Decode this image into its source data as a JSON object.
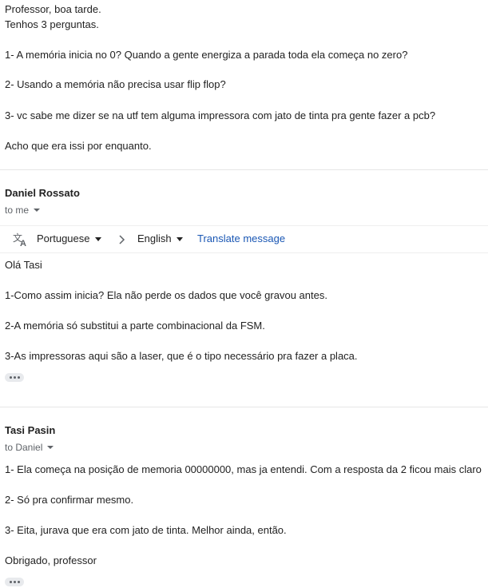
{
  "message1": {
    "lines": [
      "Professor, boa tarde.",
      "Tenhos 3 perguntas.",
      "1- A memória inicia no 0? Quando a gente energiza a parada toda ela começa no zero?",
      "2- Usando a memória não precisa usar flip flop?",
      "3- vc sabe me dizer se na utf tem alguma impressora com jato de tinta pra gente fazer a pcb?",
      "Acho que era issi por enquanto."
    ]
  },
  "message2": {
    "sender": "Daniel Rossato",
    "recipient": "to me",
    "translate": {
      "source_lang": "Portuguese",
      "target_lang": "English",
      "link": "Translate message"
    },
    "lines": [
      "Olá Tasi",
      "1-Como assim inicia? Ela não perde os dados que você gravou antes.",
      "2-A memória só substitui a parte combinacional da FSM.",
      "3-As impressoras aqui são a laser, que é o tipo necessário pra fazer a placa."
    ]
  },
  "message3": {
    "sender": "Tasi Pasin",
    "recipient": "to Daniel",
    "lines": [
      "1- Ela começa na posição de memoria 00000000, mas ja entendi. Com a resposta da 2 ficou mais claro",
      "2- Só pra confirmar mesmo.",
      "3- Eita, jurava que era com jato de tinta. Melhor ainda, então.",
      "Obrigado, professor"
    ]
  },
  "icons": {
    "translate": "translate-icon",
    "caret": "caret-down-icon",
    "chevron": "chevron-right-icon",
    "more": "more-horiz-icon"
  },
  "colors": {
    "link": "#1a57b4",
    "muted": "#5f6368",
    "text": "#222222"
  }
}
